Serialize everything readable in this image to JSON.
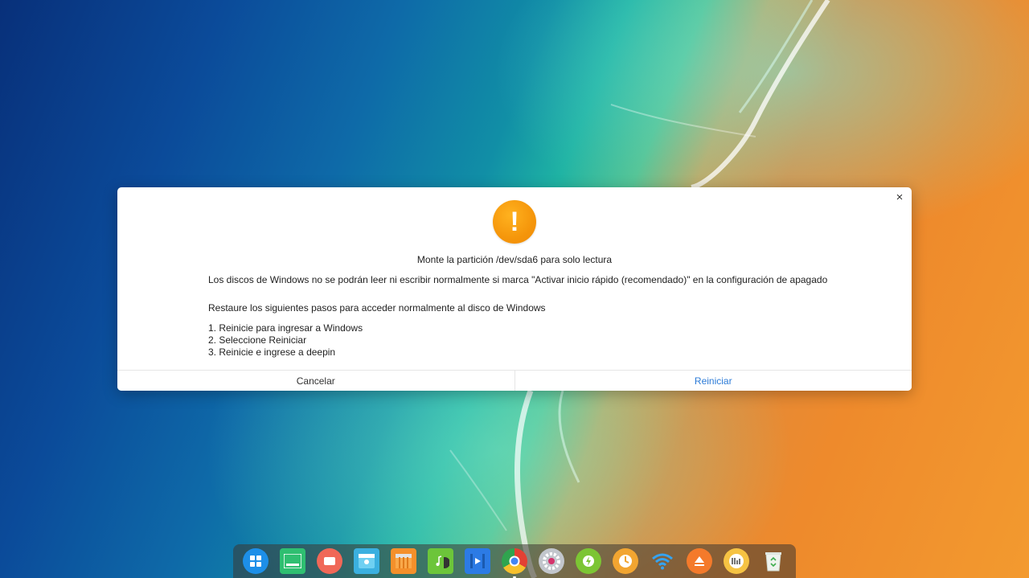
{
  "dialog": {
    "title": "Monte la partición /dev/sda6 para solo lectura",
    "line1": "Los discos de Windows no se podrán leer ni escribir normalmente si marca \"Activar inicio rápido (recomendado)\" en la configuración de apagado",
    "line2": "Restaure los siguientes pasos para acceder normalmente al disco de Windows",
    "steps": [
      "1. Reinicie para ingresar a Windows",
      "2. Seleccione Reiniciar",
      "3. Reinicie e ingrese a deepin"
    ],
    "close_label": "×",
    "warning_glyph": "!",
    "cancel_label": "Cancelar",
    "confirm_label": "Reiniciar",
    "accent_color": "#2c7bd7",
    "warning_color": "#f5960b"
  },
  "dock": {
    "items": [
      {
        "icon": "launcher-icon",
        "color": "#1d8fe8"
      },
      {
        "icon": "terminal-icon",
        "color": "#2fbf71"
      },
      {
        "icon": "screen-recorder-icon",
        "color": "#f06858"
      },
      {
        "icon": "file-manager-icon",
        "color": "#3bb0e0"
      },
      {
        "icon": "app-store-icon",
        "color": "#f4902b"
      },
      {
        "icon": "music-icon",
        "color": "#6cc53a"
      },
      {
        "icon": "movie-icon",
        "color": "#2c7be5"
      },
      {
        "icon": "chrome-icon",
        "color": "#e34133"
      },
      {
        "icon": "settings-icon",
        "color": "#c2c6cc"
      },
      {
        "icon": "power-manager-icon",
        "color": "#7cc534"
      },
      {
        "icon": "clock-icon",
        "color": "#f2a531"
      },
      {
        "icon": "wifi-icon",
        "color": "#2b8ee6"
      },
      {
        "icon": "eject-icon",
        "color": "#f47a2b"
      },
      {
        "icon": "system-monitor-icon",
        "color": "#f6c343"
      },
      {
        "icon": "trash-icon",
        "color": "#e9efe9"
      }
    ]
  }
}
